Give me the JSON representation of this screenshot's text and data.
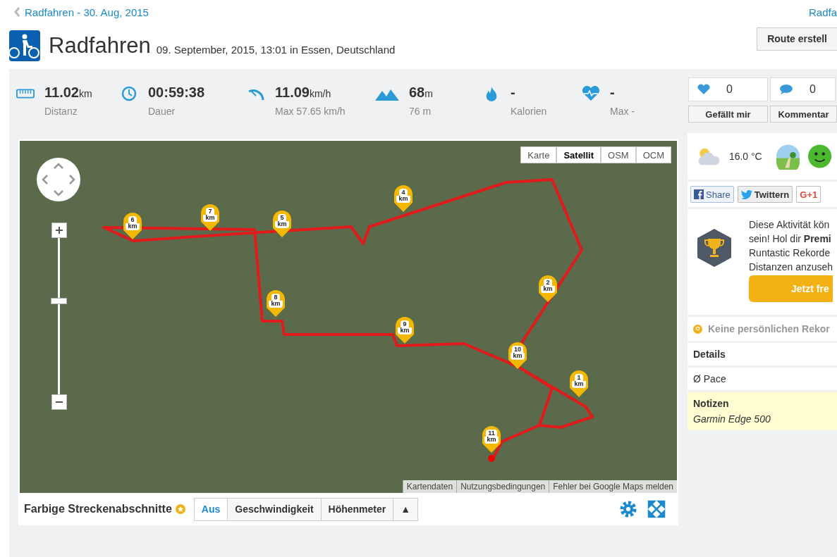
{
  "back_link": "Radfahren - 30. Aug, 2015",
  "next_link": "Radfa",
  "header": {
    "title": "Radfahren",
    "subtitle": "09. September, 2015, 13:01 in Essen, Deutschland",
    "route_button": "Route erstell"
  },
  "stats": [
    {
      "kind": "distance",
      "value": "11.02",
      "unit": "km",
      "label": "Distanz"
    },
    {
      "kind": "duration",
      "value": "00:59:38",
      "label": "Dauer"
    },
    {
      "kind": "speed",
      "value": "11.09",
      "unit": "km/h",
      "label": "Max 57.65 km/h"
    },
    {
      "kind": "elevation",
      "value": "68",
      "unit": "m",
      "label": "76 m"
    },
    {
      "kind": "calories",
      "value": "-",
      "label": "Kalorien"
    },
    {
      "kind": "heart",
      "value": "-",
      "label": "Max -"
    }
  ],
  "map": {
    "zoom": {
      "level": 0.6
    },
    "map_types": [
      {
        "label": "Karte",
        "selected": false
      },
      {
        "label": "Satellit",
        "selected": true
      },
      {
        "label": "OSM",
        "selected": false
      },
      {
        "label": "OCM",
        "selected": false
      }
    ],
    "markers": [
      {
        "number": "6",
        "unit": "km"
      },
      {
        "number": "7",
        "unit": "km"
      },
      {
        "number": "5",
        "unit": "km"
      },
      {
        "number": "4",
        "unit": "km"
      },
      {
        "number": "2",
        "unit": "km"
      },
      {
        "number": "8",
        "unit": "km"
      },
      {
        "number": "9",
        "unit": "km"
      },
      {
        "number": "10",
        "unit": "km"
      },
      {
        "number": "1",
        "unit": "km"
      },
      {
        "number": "11",
        "unit": "km"
      }
    ],
    "footer_links": [
      "Kartendaten",
      "Nutzungsbedingungen",
      "Fehler bei Google Maps melden"
    ]
  },
  "segments": {
    "label": "Farbige Streckenabschnitte",
    "options": [
      {
        "label": "Aus",
        "selected": true
      },
      {
        "label": "Geschwindigkeit",
        "selected": false
      },
      {
        "label": "Höhenmeter",
        "selected": false
      }
    ],
    "toggle": "▲"
  },
  "social": {
    "likes": "0",
    "comments": "0",
    "like_button": "Gefällt mir",
    "comment_button": "Kommentar"
  },
  "weather": {
    "temperature": "16.0 °C"
  },
  "share_buttons": [
    {
      "kind": "facebook",
      "label": "Share"
    },
    {
      "kind": "twitter",
      "label": "Twittern"
    },
    {
      "kind": "google",
      "label": "G+1"
    }
  ],
  "promo": {
    "lines": [
      "Diese Aktivität kön",
      "sein! Hol dir **Premi**",
      "Runtastic Rekorde",
      "Distanzen anzuseh"
    ],
    "button": "Jetzt fre"
  },
  "records": "Keine persönlichen Rekor",
  "details": {
    "title": "Details",
    "rows": [
      "Ø Pace"
    ]
  },
  "notes": {
    "title": "Notizen",
    "text": "Garmin Edge 500"
  }
}
